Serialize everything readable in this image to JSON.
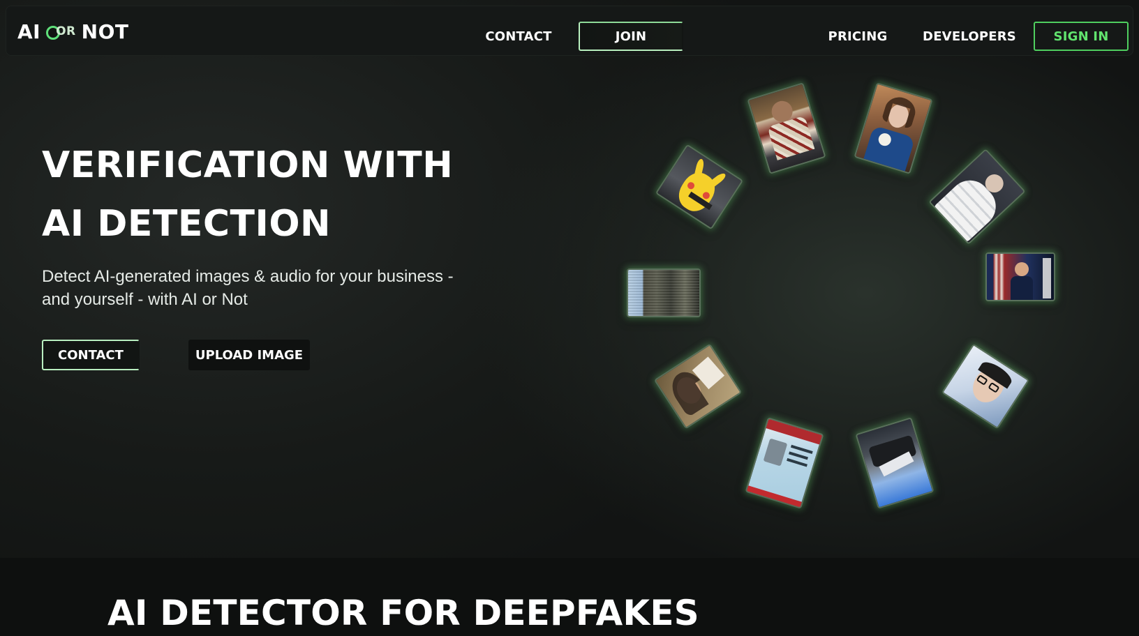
{
  "nav": {
    "logo_left": "AI",
    "logo_mid": "OR",
    "logo_right": "NOT",
    "contact": "CONTACT",
    "join": "JOIN",
    "pricing": "PRICING",
    "developers": "DEVELOPERS",
    "sign_in": "SIGN IN"
  },
  "hero": {
    "title_line1": "VERIFICATION WITH",
    "title_line2": "AI DETECTION",
    "subtitle_line1": "Detect AI-generated images & audio for your business -",
    "subtitle_line2": "and yourself - with AI or Not",
    "contact_button": "CONTACT",
    "upload_button": "UPLOAD IMAGE"
  },
  "gallery": {
    "accent_glow": "#8cff96",
    "images": [
      {
        "name": "man-floral-shirt-image"
      },
      {
        "name": "woman-portrait-image"
      },
      {
        "name": "white-puffer-jacket-image"
      },
      {
        "name": "political-poster-image"
      },
      {
        "name": "man-glasses-image"
      },
      {
        "name": "crashed-vehicle-image"
      },
      {
        "name": "id-card-image"
      },
      {
        "name": "woman-selfie-image"
      },
      {
        "name": "crowd-aerial-image"
      },
      {
        "name": "pikachu-image"
      }
    ]
  },
  "lower_section": {
    "title": "AI DETECTOR FOR DEEPFAKES"
  },
  "colors": {
    "accent_green": "#61e36e",
    "background": "#121413",
    "text": "#ffffff"
  }
}
